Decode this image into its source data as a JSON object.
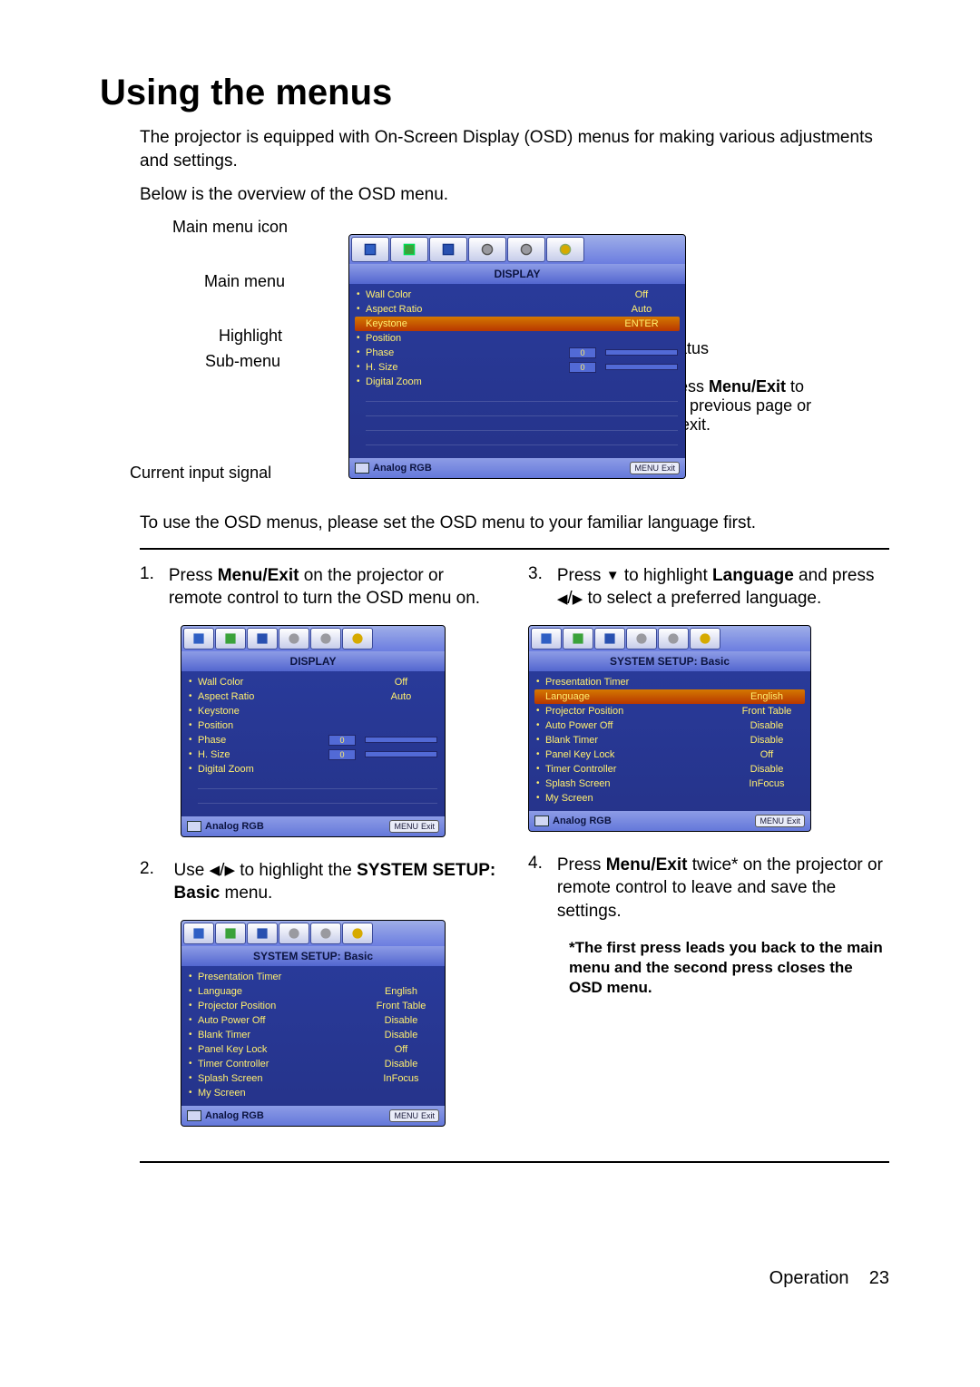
{
  "heading": "Using the menus",
  "intro1": "The projector is equipped with On-Screen Display (OSD) menus for making various adjustments and settings.",
  "intro2": "Below is the overview of the OSD menu.",
  "labels": {
    "main_menu_icon": "Main menu icon",
    "main_menu": "Main menu",
    "highlight": "Highlight",
    "sub_menu": "Sub-menu",
    "current_input_signal": "Current input signal",
    "status": "Status",
    "press_menu_exit": "Press ",
    "press_menu_exit_bold": "Menu/Exit",
    "press_menu_exit_tail": " to the previous page or to exit."
  },
  "osd_big": {
    "title": "DISPLAY",
    "rows": [
      {
        "k": "Wall Color",
        "v": "Off",
        "bullet": true
      },
      {
        "k": "Aspect Ratio",
        "v": "Auto",
        "bullet": true
      },
      {
        "k": "Keystone",
        "v": "ENTER",
        "highlight": true,
        "bullet": false
      },
      {
        "k": "Position",
        "v": "",
        "bullet": true
      },
      {
        "k": "Phase",
        "num": "0",
        "bar": true,
        "bullet": true
      },
      {
        "k": "H. Size",
        "num": "0",
        "bar": true,
        "bullet": true
      },
      {
        "k": "Digital Zoom",
        "v": "",
        "bullet": true
      }
    ],
    "signal": "Analog RGB",
    "exit": [
      "MENU",
      "Exit"
    ]
  },
  "post_diagram": "To use the OSD menus, please set the OSD menu to your familiar language first.",
  "steps": {
    "s1": {
      "n": "1.",
      "text_pre": "Press ",
      "text_bold": "Menu/Exit",
      "text_post": " on the projector or remote control to turn the OSD menu on."
    },
    "s2": {
      "n": "2.",
      "text_pre": "Use ",
      "text_post": " to highlight the ",
      "text_bold": "SYSTEM SETUP: Basic",
      "text_tail": " menu."
    },
    "s3": {
      "n": "3.",
      "text_pre": "Press ",
      "text_mid1": " to highlight ",
      "text_bold": "Language",
      "text_mid2": " and press ",
      "text_post": " to select a preferred language."
    },
    "s4": {
      "n": "4.",
      "text_pre": "Press ",
      "text_bold": "Menu/Exit",
      "text_post": " twice* on the projector or remote control to leave and save the settings."
    },
    "note": "*The first press leads you back to the main menu and the second press closes the OSD menu."
  },
  "osd_small": {
    "title": "DISPLAY",
    "rows": [
      {
        "k": "Wall Color",
        "v": "Off",
        "bullet": true
      },
      {
        "k": "Aspect Ratio",
        "v": "Auto",
        "bullet": true
      },
      {
        "k": "Keystone",
        "v": "",
        "bullet": true
      },
      {
        "k": "Position",
        "v": "",
        "bullet": true
      },
      {
        "k": "Phase",
        "num": "0",
        "bar": true,
        "bullet": true
      },
      {
        "k": "H. Size",
        "num": "0",
        "bar": true,
        "bullet": true
      },
      {
        "k": "Digital Zoom",
        "v": "",
        "bullet": true
      }
    ],
    "signal": "Analog RGB",
    "exit": [
      "MENU",
      "Exit"
    ]
  },
  "osd_setup": {
    "title": "SYSTEM SETUP: Basic",
    "rows": [
      {
        "k": "Presentation Timer",
        "v": "",
        "bullet": true
      },
      {
        "k": "Language",
        "v": "English",
        "bullet": true
      },
      {
        "k": "Projector Position",
        "v": "Front Table",
        "bullet": true
      },
      {
        "k": "Auto Power Off",
        "v": "Disable",
        "bullet": true
      },
      {
        "k": "Blank Timer",
        "v": "Disable",
        "bullet": true
      },
      {
        "k": "Panel Key Lock",
        "v": "Off",
        "bullet": true
      },
      {
        "k": "Timer Controller",
        "v": "Disable",
        "bullet": true
      },
      {
        "k": "Splash Screen",
        "v": "InFocus",
        "bullet": true
      },
      {
        "k": "My Screen",
        "v": "",
        "bullet": true
      }
    ],
    "signal": "Analog RGB",
    "exit": [
      "MENU",
      "Exit"
    ]
  },
  "osd_setup_hl": {
    "title": "SYSTEM SETUP: Basic",
    "rows": [
      {
        "k": "Presentation Timer",
        "v": "",
        "bullet": true
      },
      {
        "k": "Language",
        "v": "English",
        "highlight": true,
        "bullet": false
      },
      {
        "k": "Projector Position",
        "v": "Front Table",
        "bullet": true
      },
      {
        "k": "Auto Power Off",
        "v": "Disable",
        "bullet": true
      },
      {
        "k": "Blank Timer",
        "v": "Disable",
        "bullet": true
      },
      {
        "k": "Panel Key Lock",
        "v": "Off",
        "bullet": true
      },
      {
        "k": "Timer Controller",
        "v": "Disable",
        "bullet": true
      },
      {
        "k": "Splash Screen",
        "v": "InFocus",
        "bullet": true
      },
      {
        "k": "My Screen",
        "v": "",
        "bullet": true
      }
    ],
    "signal": "Analog RGB",
    "exit": [
      "MENU",
      "Exit"
    ]
  },
  "glyphs": {
    "left": "◀",
    "right": "▶",
    "down": "▼"
  },
  "footer": {
    "section": "Operation",
    "page": "23"
  }
}
